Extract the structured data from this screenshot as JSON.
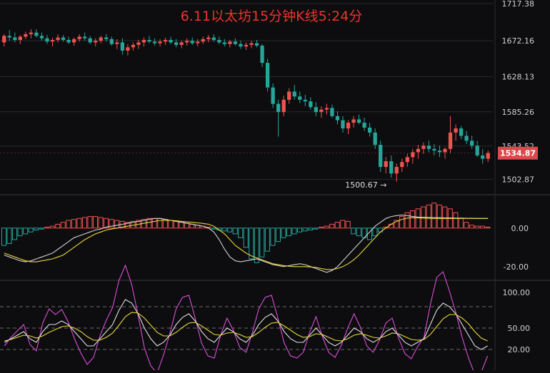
{
  "title": "6.11以太坊15分钟K线5:24分",
  "colors": {
    "background": "#0d0d0f",
    "up": "#ef5350",
    "down": "#26a69a",
    "title": "#f0322b",
    "macd_line": "#d0d0d0",
    "signal_line": "#e8d63a",
    "k_line": "#e0e0e0",
    "d_line": "#e8d63a",
    "j_line": "#d94fd6",
    "price_tag": "#e0474c",
    "grid": "#2a2a2e",
    "axis_text": "#cfcfcf"
  },
  "chart_data": [
    {
      "type": "candlestick",
      "panel": "price",
      "yticks": [
        "1717.38",
        "1672.16",
        "1628.13",
        "1585.26",
        "1543.52",
        "1502.87"
      ],
      "ylim": [
        1485,
        1720
      ],
      "last_price": "1534.87",
      "low_annotation": "1500.67",
      "candles": [
        [
          1670,
          1680,
          1665,
          1678
        ],
        [
          1678,
          1685,
          1672,
          1676
        ],
        [
          1676,
          1682,
          1670,
          1673
        ],
        [
          1673,
          1679,
          1668,
          1677
        ],
        [
          1677,
          1683,
          1674,
          1680
        ],
        [
          1680,
          1686,
          1675,
          1682
        ],
        [
          1682,
          1686,
          1676,
          1678
        ],
        [
          1678,
          1682,
          1672,
          1675
        ],
        [
          1675,
          1679,
          1668,
          1671
        ],
        [
          1671,
          1676,
          1665,
          1673
        ],
        [
          1673,
          1680,
          1670,
          1676
        ],
        [
          1676,
          1679,
          1671,
          1673
        ],
        [
          1673,
          1677,
          1668,
          1670
        ],
        [
          1670,
          1676,
          1666,
          1674
        ],
        [
          1674,
          1680,
          1671,
          1677
        ],
        [
          1677,
          1682,
          1672,
          1675
        ],
        [
          1675,
          1678,
          1668,
          1670
        ],
        [
          1670,
          1675,
          1665,
          1672
        ],
        [
          1672,
          1678,
          1669,
          1676
        ],
        [
          1676,
          1680,
          1671,
          1674
        ],
        [
          1674,
          1677,
          1666,
          1668
        ],
        [
          1668,
          1674,
          1662,
          1670
        ],
        [
          1670,
          1675,
          1655,
          1660
        ],
        [
          1660,
          1668,
          1654,
          1664
        ],
        [
          1664,
          1670,
          1660,
          1667
        ],
        [
          1667,
          1673,
          1662,
          1670
        ],
        [
          1670,
          1676,
          1665,
          1673
        ],
        [
          1673,
          1678,
          1669,
          1671
        ],
        [
          1671,
          1675,
          1666,
          1669
        ],
        [
          1669,
          1674,
          1665,
          1671
        ],
        [
          1671,
          1676,
          1667,
          1673
        ],
        [
          1673,
          1677,
          1668,
          1670
        ],
        [
          1670,
          1674,
          1664,
          1667
        ],
        [
          1667,
          1672,
          1663,
          1670
        ],
        [
          1670,
          1675,
          1666,
          1672
        ],
        [
          1672,
          1676,
          1667,
          1669
        ],
        [
          1669,
          1674,
          1665,
          1671
        ],
        [
          1671,
          1677,
          1668,
          1674
        ],
        [
          1674,
          1679,
          1670,
          1676
        ],
        [
          1676,
          1680,
          1671,
          1673
        ],
        [
          1673,
          1677,
          1668,
          1670
        ],
        [
          1670,
          1674,
          1665,
          1668
        ],
        [
          1668,
          1673,
          1664,
          1671
        ],
        [
          1671,
          1675,
          1666,
          1668
        ],
        [
          1668,
          1672,
          1662,
          1665
        ],
        [
          1665,
          1670,
          1661,
          1667
        ],
        [
          1667,
          1672,
          1663,
          1669
        ],
        [
          1669,
          1673,
          1664,
          1666
        ],
        [
          1666,
          1668,
          1640,
          1645
        ],
        [
          1645,
          1650,
          1610,
          1615
        ],
        [
          1615,
          1620,
          1590,
          1595
        ],
        [
          1595,
          1600,
          1555,
          1585
        ],
        [
          1585,
          1605,
          1580,
          1600
        ],
        [
          1600,
          1614,
          1595,
          1610
        ],
        [
          1610,
          1618,
          1600,
          1604
        ],
        [
          1604,
          1610,
          1596,
          1600
        ],
        [
          1600,
          1606,
          1592,
          1598
        ],
        [
          1598,
          1603,
          1588,
          1591
        ],
        [
          1591,
          1597,
          1580,
          1585
        ],
        [
          1585,
          1592,
          1578,
          1588
        ],
        [
          1588,
          1595,
          1582,
          1590
        ],
        [
          1590,
          1594,
          1578,
          1580
        ],
        [
          1580,
          1586,
          1570,
          1575
        ],
        [
          1575,
          1580,
          1560,
          1565
        ],
        [
          1565,
          1575,
          1558,
          1572
        ],
        [
          1572,
          1580,
          1566,
          1576
        ],
        [
          1576,
          1582,
          1570,
          1572
        ],
        [
          1572,
          1578,
          1562,
          1566
        ],
        [
          1566,
          1572,
          1555,
          1560
        ],
        [
          1560,
          1565,
          1540,
          1545
        ],
        [
          1545,
          1550,
          1512,
          1518
        ],
        [
          1518,
          1530,
          1510,
          1525
        ],
        [
          1525,
          1532,
          1505,
          1510
        ],
        [
          1510,
          1522,
          1500,
          1518
        ],
        [
          1518,
          1528,
          1512,
          1524
        ],
        [
          1524,
          1534,
          1518,
          1530
        ],
        [
          1530,
          1540,
          1522,
          1536
        ],
        [
          1536,
          1545,
          1528,
          1540
        ],
        [
          1540,
          1548,
          1534,
          1544
        ],
        [
          1544,
          1550,
          1536,
          1540
        ],
        [
          1540,
          1546,
          1532,
          1538
        ],
        [
          1538,
          1544,
          1530,
          1536
        ],
        [
          1536,
          1542,
          1528,
          1540
        ],
        [
          1540,
          1580,
          1535,
          1560
        ],
        [
          1560,
          1570,
          1550,
          1565
        ],
        [
          1565,
          1568,
          1552,
          1556
        ],
        [
          1556,
          1562,
          1546,
          1550
        ],
        [
          1550,
          1556,
          1540,
          1544
        ],
        [
          1544,
          1550,
          1530,
          1532
        ],
        [
          1532,
          1540,
          1522,
          1528
        ],
        [
          1528,
          1538,
          1524,
          1535
        ]
      ]
    },
    {
      "type": "macd",
      "panel": "macd",
      "yticks": [
        "0.00",
        "-20.00"
      ],
      "ylim": [
        -26,
        14
      ],
      "histogram": [
        -9,
        -8,
        -6,
        -4,
        -3,
        -2,
        -1,
        -0.5,
        0.5,
        1,
        2,
        3,
        4,
        4.5,
        5,
        5.5,
        6,
        6,
        5.5,
        5,
        4.5,
        4,
        3.5,
        3,
        3.5,
        4,
        4.5,
        5,
        5,
        5,
        4.5,
        4,
        3.5,
        3,
        2.5,
        2,
        1.5,
        1,
        0.5,
        -0.5,
        -1,
        -1.5,
        -2,
        -3,
        -5,
        -10,
        -16,
        -18,
        -15,
        -12,
        -9,
        -7,
        -5,
        -4,
        -3,
        -2,
        -1.5,
        -1,
        -0.5,
        0.5,
        1,
        2,
        3,
        4,
        3.5,
        -3,
        -4,
        -5,
        -6,
        -4,
        -2,
        0.5,
        2,
        4,
        6,
        8,
        9,
        10,
        11,
        12,
        13,
        12,
        11,
        10,
        8,
        5,
        3,
        1.5,
        1,
        1,
        0.5
      ],
      "macd": [
        -14,
        -15,
        -16,
        -17,
        -17.5,
        -17,
        -16,
        -15,
        -14,
        -13,
        -11,
        -9,
        -7,
        -5,
        -4,
        -3,
        -2,
        -1,
        -0.5,
        0.5,
        1,
        1.5,
        2,
        2.5,
        3,
        3.5,
        4,
        4.5,
        5,
        5,
        4.5,
        4,
        3.5,
        3,
        2.5,
        2,
        1.5,
        1,
        0,
        -2,
        -6,
        -11,
        -15,
        -17,
        -17.5,
        -17,
        -16.5,
        -16,
        -17,
        -18,
        -19,
        -19.5,
        -20,
        -19.5,
        -19,
        -18.5,
        -19,
        -20,
        -21,
        -22,
        -23,
        -22,
        -20,
        -17,
        -14,
        -11,
        -8,
        -5,
        -2,
        1,
        3,
        5,
        6,
        6.5,
        6.8,
        6.5,
        6.0,
        5.7,
        5.6,
        5.5,
        5.4,
        5.4,
        5.3,
        5.3,
        5.2,
        5.2,
        5.1,
        5.1,
        5.0,
        5.0,
        5.0
      ],
      "signal": [
        -13,
        -14,
        -15,
        -16,
        -17,
        -17.5,
        -17.5,
        -17,
        -16.5,
        -16,
        -15,
        -14,
        -12,
        -10,
        -8,
        -6,
        -4.5,
        -3,
        -2,
        -1,
        -0.5,
        0,
        0.5,
        1,
        1.5,
        2,
        2.5,
        3,
        3.5,
        4,
        4,
        4,
        3.8,
        3.5,
        3.2,
        3,
        2.7,
        2.4,
        2,
        1,
        -1,
        -3,
        -6,
        -9,
        -11,
        -13,
        -14.5,
        -15.5,
        -16.5,
        -17.5,
        -18.5,
        -19,
        -19.5,
        -19.8,
        -20,
        -20,
        -20,
        -20.2,
        -20.5,
        -21,
        -21.5,
        -21.5,
        -21,
        -20,
        -18.5,
        -16.5,
        -14,
        -11,
        -8,
        -5,
        -2,
        0,
        2,
        3.5,
        4.5,
        5.2,
        5.4,
        5.3,
        5.2,
        5.1,
        5.0,
        5.0,
        5.0,
        5.0,
        5.0,
        5.0,
        5.0,
        5.0,
        5.0,
        5.0,
        5.0
      ]
    },
    {
      "type": "kdj",
      "panel": "kdj",
      "yticks": [
        "100.00",
        "50.00",
        "20.00"
      ],
      "ylim": [
        -5,
        110
      ],
      "reference_levels": [
        80,
        50,
        20
      ],
      "k": [
        30,
        35,
        40,
        45,
        35,
        30,
        45,
        55,
        55,
        60,
        55,
        45,
        35,
        25,
        25,
        35,
        45,
        55,
        75,
        90,
        85,
        70,
        50,
        35,
        25,
        30,
        40,
        55,
        65,
        70,
        60,
        45,
        35,
        30,
        40,
        50,
        45,
        35,
        30,
        40,
        55,
        65,
        70,
        60,
        45,
        35,
        30,
        30,
        40,
        50,
        40,
        30,
        25,
        30,
        40,
        50,
        45,
        35,
        30,
        35,
        45,
        50,
        40,
        30,
        25,
        30,
        35,
        55,
        75,
        85,
        80,
        70,
        55,
        40,
        25,
        20,
        25
      ],
      "d": [
        32,
        34,
        37,
        40,
        39,
        36,
        39,
        44,
        48,
        52,
        53,
        50,
        45,
        38,
        33,
        33,
        37,
        43,
        54,
        66,
        72,
        71,
        64,
        54,
        44,
        39,
        39,
        44,
        51,
        57,
        58,
        53,
        47,
        41,
        40,
        43,
        44,
        41,
        37,
        38,
        44,
        51,
        57,
        58,
        53,
        47,
        41,
        37,
        38,
        42,
        41,
        37,
        33,
        32,
        35,
        40,
        42,
        40,
        37,
        36,
        39,
        43,
        42,
        38,
        34,
        33,
        34,
        41,
        52,
        63,
        69,
        69,
        64,
        56,
        45,
        36,
        32
      ],
      "j": [
        25,
        37,
        46,
        55,
        27,
        18,
        57,
        77,
        69,
        76,
        59,
        35,
        15,
        -1,
        9,
        39,
        61,
        79,
        117,
        138,
        111,
        68,
        22,
        -3,
        -13,
        12,
        42,
        77,
        93,
        96,
        64,
        29,
        11,
        8,
        40,
        64,
        47,
        23,
        16,
        44,
        77,
        93,
        96,
        64,
        29,
        11,
        8,
        16,
        44,
        66,
        38,
        16,
        9,
        26,
        50,
        70,
        51,
        25,
        16,
        33,
        57,
        64,
        36,
        14,
        7,
        24,
        37,
        83,
        121,
        129,
        102,
        72,
        37,
        8,
        -15,
        -12,
        11
      ]
    }
  ]
}
